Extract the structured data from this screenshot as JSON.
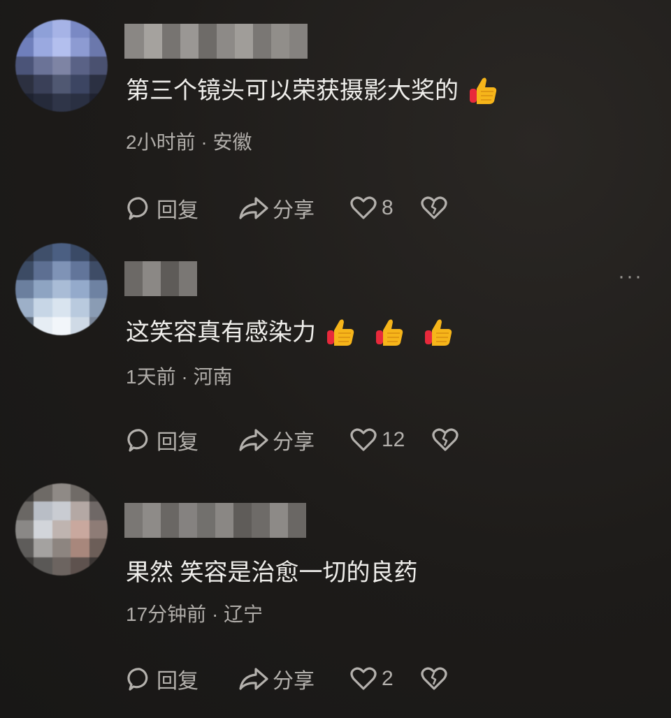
{
  "comments": [
    {
      "text": "第三个镜头可以荣获摄影大奖的",
      "emojis": [
        "thumbs-up-emoji"
      ],
      "time": "2小时前",
      "separator": "·",
      "location": "安徽",
      "reply_label": "回复",
      "share_label": "分享",
      "likes": "8",
      "show_more": false
    },
    {
      "text": "这笑容真有感染力",
      "emojis": [
        "thumbs-up-emoji",
        "thumbs-up-emoji",
        "thumbs-up-emoji"
      ],
      "time": "1天前",
      "separator": "·",
      "location": "河南",
      "reply_label": "回复",
      "share_label": "分享",
      "likes": "12",
      "show_more": true
    },
    {
      "text": "果然 笑容是治愈一切的良药",
      "emojis": [],
      "time": "17分钟前",
      "separator": "·",
      "location": "辽宁",
      "reply_label": "回复",
      "share_label": "分享",
      "likes": "2",
      "show_more": false
    }
  ],
  "more_label": "···",
  "colors": {
    "background": "#1d1b19",
    "text": "#efeeeb",
    "muted": "#b1aeaa"
  }
}
